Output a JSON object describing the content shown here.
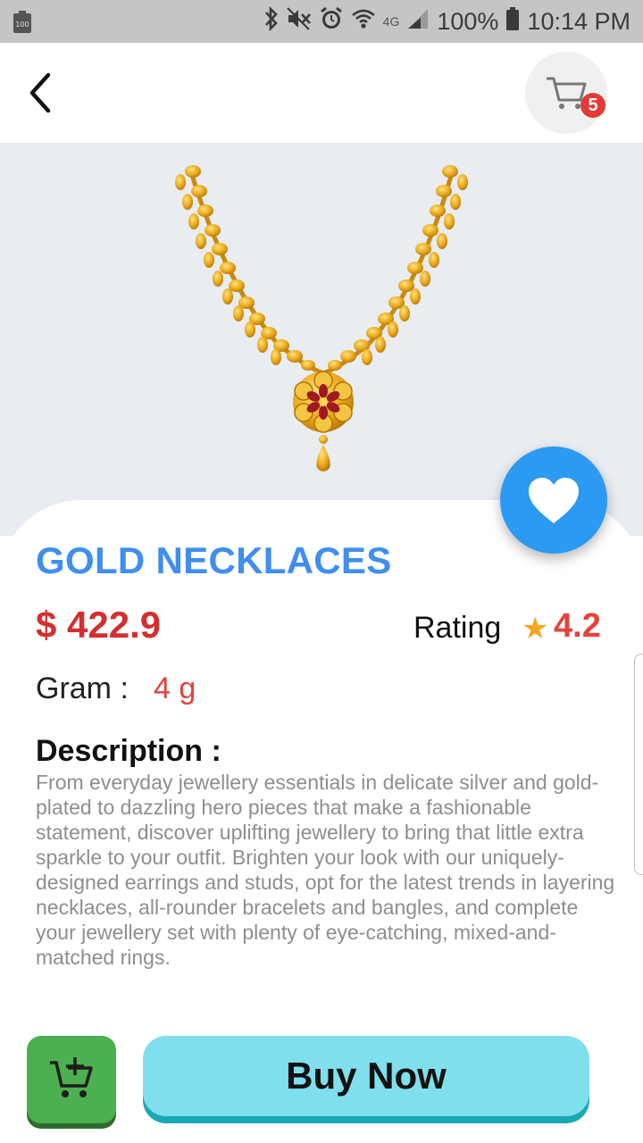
{
  "status_bar": {
    "battery_left_label": "100",
    "network_label": "4G",
    "battery_percent": "100%",
    "time": "10:14 PM"
  },
  "header": {
    "back_icon": "chevron-left-icon",
    "cart_icon": "cart-icon",
    "cart_badge_count": "5"
  },
  "product": {
    "title": "GOLD NECKLACES",
    "price": "$ 422.9",
    "rating_label": "Rating",
    "rating_value": "4.2",
    "gram_label": "Gram :",
    "gram_value": "4 g",
    "description_title": "Description :",
    "description": "From everyday jewellery essentials in delicate silver and gold-plated to dazzling hero pieces that make a fashionable statement, discover uplifting jewellery to bring that little extra sparkle to your outfit. Brighten your look with our uniquely-designed earrings and studs, opt for the latest trends in layering necklaces, all-rounder bracelets and bangles, and complete your jewellery set with plenty of eye-catching, mixed-and-matched rings."
  },
  "actions": {
    "buy_now": "Buy Now",
    "add_to_cart_icon": "cart-plus-icon"
  },
  "colors": {
    "title_blue": "#3f8ef0",
    "price_red": "#d32f2f",
    "fav_blue": "#2b9af3",
    "add_cart_green": "#4caf50",
    "buy_cyan": "#7fdfec",
    "star": "#f5a623"
  }
}
